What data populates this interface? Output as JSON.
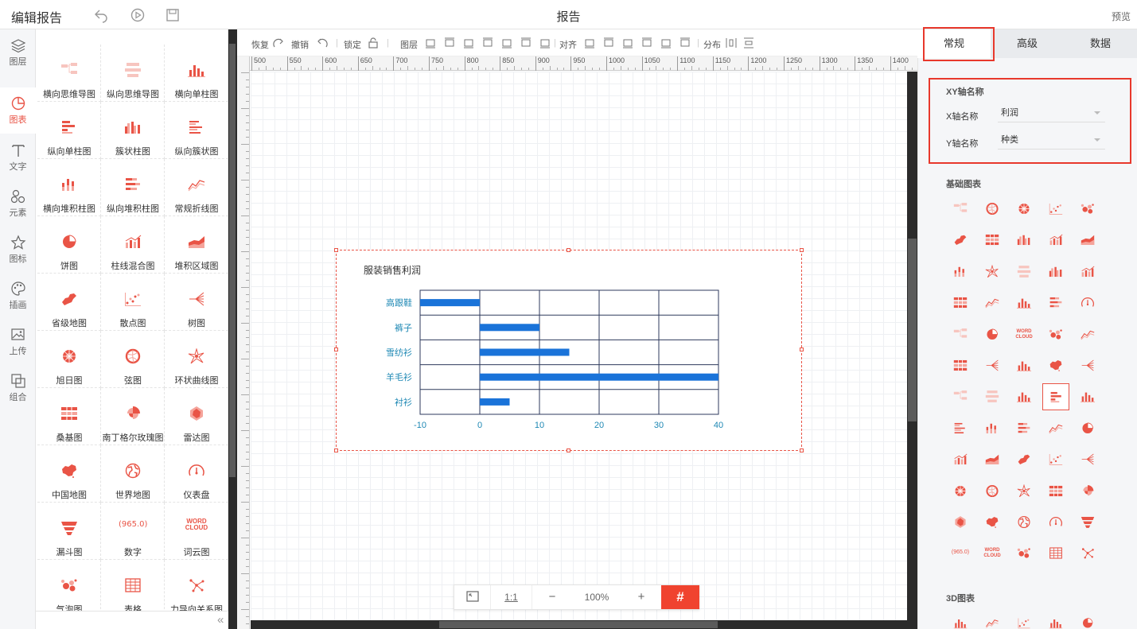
{
  "app": {
    "title": "编辑报告",
    "center_title": "报告",
    "preview": "预览"
  },
  "rail": [
    {
      "label": "图层",
      "icon": "layers-icon"
    },
    {
      "label": "图表",
      "icon": "chart-pie-icon",
      "active": true
    },
    {
      "label": "文字",
      "icon": "text-icon"
    },
    {
      "label": "元素",
      "icon": "shapes-icon"
    },
    {
      "label": "图标",
      "icon": "star-icon"
    },
    {
      "label": "插画",
      "icon": "palette-icon"
    },
    {
      "label": "上传",
      "icon": "upload-image-icon"
    },
    {
      "label": "组合",
      "icon": "group-icon"
    }
  ],
  "palette": [
    {
      "label": "横向思维导图",
      "icon": "mindmap-h-icon"
    },
    {
      "label": "纵向思维导图",
      "icon": "mindmap-v-icon"
    },
    {
      "label": "横向单柱图",
      "icon": "bar-v-icon"
    },
    {
      "label": "纵向单柱图",
      "icon": "bar-h-icon"
    },
    {
      "label": "簇状柱图",
      "icon": "bar-cluster-icon"
    },
    {
      "label": "纵向簇状图",
      "icon": "bar-h-cluster-icon"
    },
    {
      "label": "横向堆积柱图",
      "icon": "bar-stack-icon"
    },
    {
      "label": "纵向堆积柱图",
      "icon": "bar-h-stack-icon"
    },
    {
      "label": "常规折线图",
      "icon": "line-icon"
    },
    {
      "label": "饼图",
      "icon": "pie-icon"
    },
    {
      "label": "柱线混合图",
      "icon": "bar-line-icon"
    },
    {
      "label": "堆积区域图",
      "icon": "area-icon"
    },
    {
      "label": "省级地图",
      "icon": "province-map-icon"
    },
    {
      "label": "散点图",
      "icon": "scatter-icon"
    },
    {
      "label": "树图",
      "icon": "tree-icon"
    },
    {
      "label": "旭日图",
      "icon": "sunburst-icon"
    },
    {
      "label": "弦图",
      "icon": "chord-icon"
    },
    {
      "label": "环状曲线图",
      "icon": "radial-curve-icon"
    },
    {
      "label": "桑基图",
      "icon": "sankey-icon"
    },
    {
      "label": "南丁格尔玫瑰图",
      "icon": "rose-icon"
    },
    {
      "label": "雷达图",
      "icon": "radar-icon"
    },
    {
      "label": "中国地图",
      "icon": "china-map-icon"
    },
    {
      "label": "世界地图",
      "icon": "world-map-icon"
    },
    {
      "label": "仪表盘",
      "icon": "gauge-icon"
    },
    {
      "label": "漏斗图",
      "icon": "funnel-icon"
    },
    {
      "label": "数字",
      "icon": "number-icon"
    },
    {
      "label": "词云图",
      "icon": "wordcloud-icon"
    },
    {
      "label": "气泡图",
      "icon": "bubble-icon"
    },
    {
      "label": "表格",
      "icon": "table-icon"
    },
    {
      "label": "力导向关系图",
      "icon": "force-graph-icon"
    }
  ],
  "palette_number_text": "965.0",
  "palette_word_text": [
    "WORD",
    "CLOUD"
  ],
  "toolbar": {
    "redo": "恢复",
    "undo": "撤销",
    "lock": "锁定",
    "layer": "图层",
    "align": "对齐",
    "distribute": "分布"
  },
  "ruler_ticks": [
    "500",
    "550",
    "600",
    "650",
    "700",
    "750",
    "800",
    "850",
    "900",
    "950",
    "1000",
    "1050",
    "1100",
    "1150",
    "1200",
    "1250",
    "1300",
    "1350",
    "1400"
  ],
  "zoom": {
    "fit": "⤢",
    "one_to_one": "1:1",
    "minus": "−",
    "level": "100%",
    "plus": "+",
    "grid": "#"
  },
  "tabs": [
    "常规",
    "高级",
    "数据"
  ],
  "active_tab": "常规",
  "xy_section": {
    "title": "XY轴名称",
    "x_label": "X轴名称",
    "x_value": "利润",
    "y_label": "Y轴名称",
    "y_value": "种类"
  },
  "basic_charts_title": "基础图表",
  "charts3d_title": "3D图表",
  "accent_color": "#e95446",
  "bar_color": "#1a73d9",
  "chart_data": {
    "type": "bar",
    "orientation": "horizontal",
    "title": "服装销售利润",
    "categories": [
      "高跟鞋",
      "裤子",
      "雪纺衫",
      "羊毛衫",
      "衬衫"
    ],
    "values": [
      -10,
      10,
      15,
      40,
      5
    ],
    "xlim": [
      -10,
      40
    ],
    "xticks": [
      "-10",
      "0",
      "10",
      "20",
      "30",
      "40"
    ],
    "grid": true,
    "legend": "none"
  }
}
